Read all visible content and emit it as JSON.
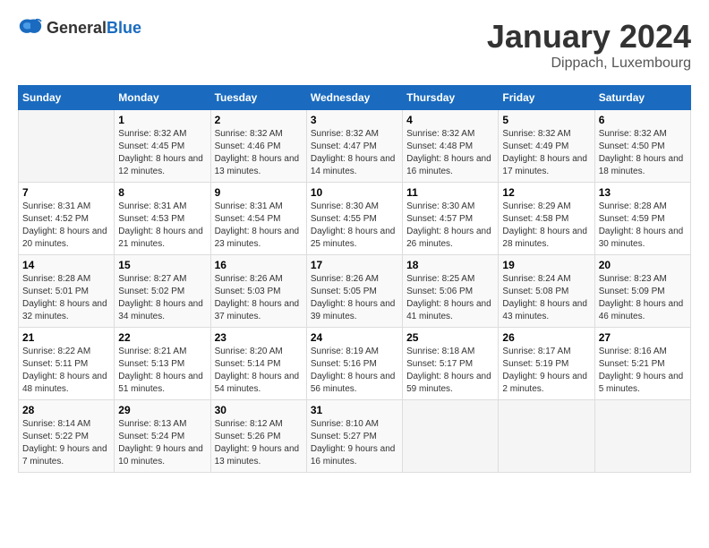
{
  "header": {
    "logo_general": "General",
    "logo_blue": "Blue",
    "month": "January 2024",
    "location": "Dippach, Luxembourg"
  },
  "days_of_week": [
    "Sunday",
    "Monday",
    "Tuesday",
    "Wednesday",
    "Thursday",
    "Friday",
    "Saturday"
  ],
  "weeks": [
    [
      {
        "day": "",
        "sunrise": "",
        "sunset": "",
        "daylight": ""
      },
      {
        "day": "1",
        "sunrise": "Sunrise: 8:32 AM",
        "sunset": "Sunset: 4:45 PM",
        "daylight": "Daylight: 8 hours and 12 minutes."
      },
      {
        "day": "2",
        "sunrise": "Sunrise: 8:32 AM",
        "sunset": "Sunset: 4:46 PM",
        "daylight": "Daylight: 8 hours and 13 minutes."
      },
      {
        "day": "3",
        "sunrise": "Sunrise: 8:32 AM",
        "sunset": "Sunset: 4:47 PM",
        "daylight": "Daylight: 8 hours and 14 minutes."
      },
      {
        "day": "4",
        "sunrise": "Sunrise: 8:32 AM",
        "sunset": "Sunset: 4:48 PM",
        "daylight": "Daylight: 8 hours and 16 minutes."
      },
      {
        "day": "5",
        "sunrise": "Sunrise: 8:32 AM",
        "sunset": "Sunset: 4:49 PM",
        "daylight": "Daylight: 8 hours and 17 minutes."
      },
      {
        "day": "6",
        "sunrise": "Sunrise: 8:32 AM",
        "sunset": "Sunset: 4:50 PM",
        "daylight": "Daylight: 8 hours and 18 minutes."
      }
    ],
    [
      {
        "day": "7",
        "sunrise": "Sunrise: 8:31 AM",
        "sunset": "Sunset: 4:52 PM",
        "daylight": "Daylight: 8 hours and 20 minutes."
      },
      {
        "day": "8",
        "sunrise": "Sunrise: 8:31 AM",
        "sunset": "Sunset: 4:53 PM",
        "daylight": "Daylight: 8 hours and 21 minutes."
      },
      {
        "day": "9",
        "sunrise": "Sunrise: 8:31 AM",
        "sunset": "Sunset: 4:54 PM",
        "daylight": "Daylight: 8 hours and 23 minutes."
      },
      {
        "day": "10",
        "sunrise": "Sunrise: 8:30 AM",
        "sunset": "Sunset: 4:55 PM",
        "daylight": "Daylight: 8 hours and 25 minutes."
      },
      {
        "day": "11",
        "sunrise": "Sunrise: 8:30 AM",
        "sunset": "Sunset: 4:57 PM",
        "daylight": "Daylight: 8 hours and 26 minutes."
      },
      {
        "day": "12",
        "sunrise": "Sunrise: 8:29 AM",
        "sunset": "Sunset: 4:58 PM",
        "daylight": "Daylight: 8 hours and 28 minutes."
      },
      {
        "day": "13",
        "sunrise": "Sunrise: 8:28 AM",
        "sunset": "Sunset: 4:59 PM",
        "daylight": "Daylight: 8 hours and 30 minutes."
      }
    ],
    [
      {
        "day": "14",
        "sunrise": "Sunrise: 8:28 AM",
        "sunset": "Sunset: 5:01 PM",
        "daylight": "Daylight: 8 hours and 32 minutes."
      },
      {
        "day": "15",
        "sunrise": "Sunrise: 8:27 AM",
        "sunset": "Sunset: 5:02 PM",
        "daylight": "Daylight: 8 hours and 34 minutes."
      },
      {
        "day": "16",
        "sunrise": "Sunrise: 8:26 AM",
        "sunset": "Sunset: 5:03 PM",
        "daylight": "Daylight: 8 hours and 37 minutes."
      },
      {
        "day": "17",
        "sunrise": "Sunrise: 8:26 AM",
        "sunset": "Sunset: 5:05 PM",
        "daylight": "Daylight: 8 hours and 39 minutes."
      },
      {
        "day": "18",
        "sunrise": "Sunrise: 8:25 AM",
        "sunset": "Sunset: 5:06 PM",
        "daylight": "Daylight: 8 hours and 41 minutes."
      },
      {
        "day": "19",
        "sunrise": "Sunrise: 8:24 AM",
        "sunset": "Sunset: 5:08 PM",
        "daylight": "Daylight: 8 hours and 43 minutes."
      },
      {
        "day": "20",
        "sunrise": "Sunrise: 8:23 AM",
        "sunset": "Sunset: 5:09 PM",
        "daylight": "Daylight: 8 hours and 46 minutes."
      }
    ],
    [
      {
        "day": "21",
        "sunrise": "Sunrise: 8:22 AM",
        "sunset": "Sunset: 5:11 PM",
        "daylight": "Daylight: 8 hours and 48 minutes."
      },
      {
        "day": "22",
        "sunrise": "Sunrise: 8:21 AM",
        "sunset": "Sunset: 5:13 PM",
        "daylight": "Daylight: 8 hours and 51 minutes."
      },
      {
        "day": "23",
        "sunrise": "Sunrise: 8:20 AM",
        "sunset": "Sunset: 5:14 PM",
        "daylight": "Daylight: 8 hours and 54 minutes."
      },
      {
        "day": "24",
        "sunrise": "Sunrise: 8:19 AM",
        "sunset": "Sunset: 5:16 PM",
        "daylight": "Daylight: 8 hours and 56 minutes."
      },
      {
        "day": "25",
        "sunrise": "Sunrise: 8:18 AM",
        "sunset": "Sunset: 5:17 PM",
        "daylight": "Daylight: 8 hours and 59 minutes."
      },
      {
        "day": "26",
        "sunrise": "Sunrise: 8:17 AM",
        "sunset": "Sunset: 5:19 PM",
        "daylight": "Daylight: 9 hours and 2 minutes."
      },
      {
        "day": "27",
        "sunrise": "Sunrise: 8:16 AM",
        "sunset": "Sunset: 5:21 PM",
        "daylight": "Daylight: 9 hours and 5 minutes."
      }
    ],
    [
      {
        "day": "28",
        "sunrise": "Sunrise: 8:14 AM",
        "sunset": "Sunset: 5:22 PM",
        "daylight": "Daylight: 9 hours and 7 minutes."
      },
      {
        "day": "29",
        "sunrise": "Sunrise: 8:13 AM",
        "sunset": "Sunset: 5:24 PM",
        "daylight": "Daylight: 9 hours and 10 minutes."
      },
      {
        "day": "30",
        "sunrise": "Sunrise: 8:12 AM",
        "sunset": "Sunset: 5:26 PM",
        "daylight": "Daylight: 9 hours and 13 minutes."
      },
      {
        "day": "31",
        "sunrise": "Sunrise: 8:10 AM",
        "sunset": "Sunset: 5:27 PM",
        "daylight": "Daylight: 9 hours and 16 minutes."
      },
      {
        "day": "",
        "sunrise": "",
        "sunset": "",
        "daylight": ""
      },
      {
        "day": "",
        "sunrise": "",
        "sunset": "",
        "daylight": ""
      },
      {
        "day": "",
        "sunrise": "",
        "sunset": "",
        "daylight": ""
      }
    ]
  ]
}
